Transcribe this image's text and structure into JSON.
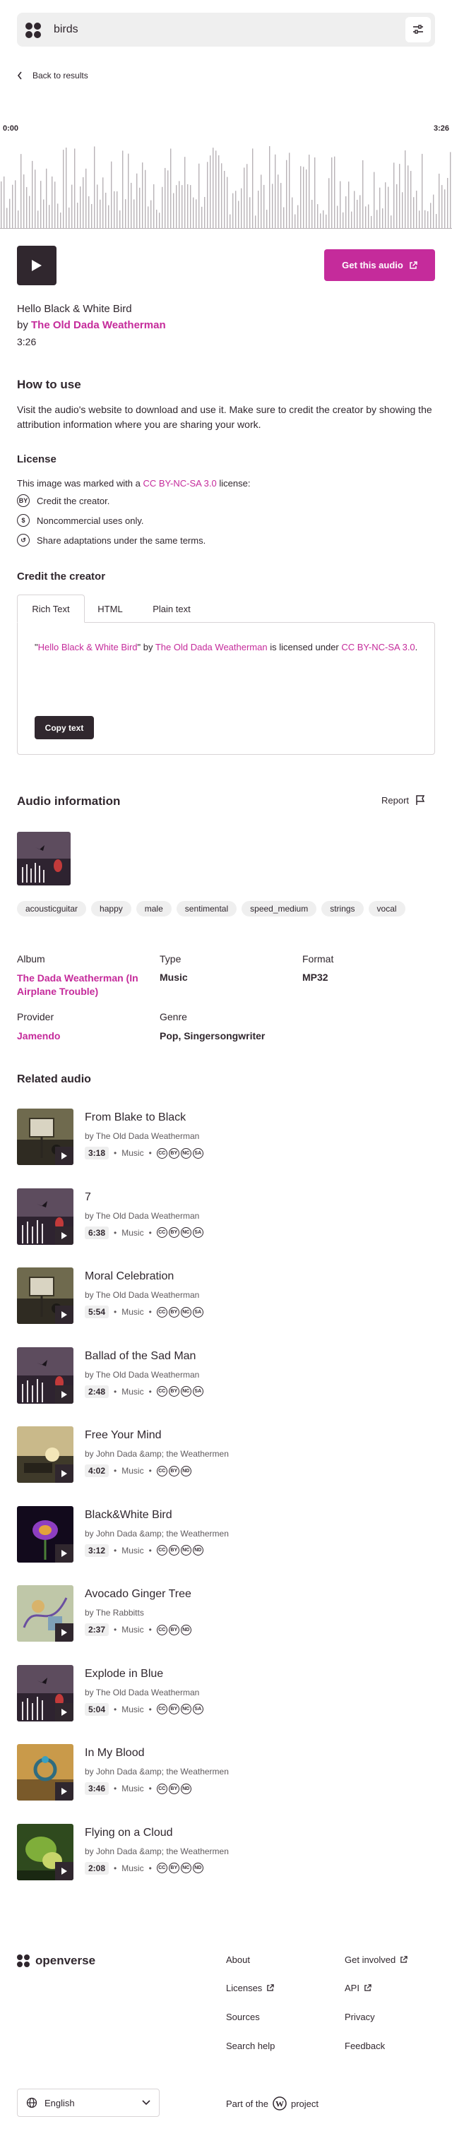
{
  "search": {
    "value": "birds"
  },
  "nav": {
    "back_label": "Back to results"
  },
  "player": {
    "current_time": "0:00",
    "total_time": "3:26",
    "get_label": "Get this audio"
  },
  "audio": {
    "title": "Hello Black & White Bird",
    "by_prefix": "by",
    "creator": "The Old Dada Weatherman",
    "duration": "3:26"
  },
  "how_to_use": {
    "heading": "How to use",
    "text": "Visit the audio's website to download and use it. Make sure to credit the creator by showing the attribution information where you are sharing your work."
  },
  "license": {
    "heading": "License",
    "intro_prefix": "This image was marked with a",
    "license_name": "CC BY-NC-SA 3.0",
    "intro_suffix": "license:",
    "items": [
      {
        "icon": "by-icon",
        "glyph": "BY",
        "text": "Credit the creator."
      },
      {
        "icon": "nc-icon",
        "glyph": "$",
        "text": "Noncommercial uses only."
      },
      {
        "icon": "sa-icon",
        "glyph": "↺",
        "text": "Share adaptations under the same terms."
      }
    ]
  },
  "credit": {
    "heading": "Credit the creator",
    "tabs": [
      "Rich Text",
      "HTML",
      "Plain text"
    ],
    "quote_open": "\"",
    "work": "Hello Black & White Bird",
    "quote_close": "\" by ",
    "creator": "The Old Dada Weatherman",
    "licensed_under": " is licensed under ",
    "license": "CC BY-NC-SA 3.0",
    "end": ".",
    "copy_label": "Copy text"
  },
  "info": {
    "heading": "Audio information",
    "report_label": "Report",
    "tags": [
      "acousticguitar",
      "happy",
      "male",
      "sentimental",
      "speed_medium",
      "strings",
      "vocal"
    ],
    "album_label": "Album",
    "album_value": "The Dada Weatherman (In Airplane Trouble)",
    "type_label": "Type",
    "type_value": "Music",
    "format_label": "Format",
    "format_value": "MP32",
    "provider_label": "Provider",
    "provider_value": "Jamendo",
    "genre_label": "Genre",
    "genre_value": "Pop, Singersongwriter"
  },
  "related": {
    "heading": "Related audio",
    "items": [
      {
        "title": "From Blake to Black",
        "by": "by The Old Dada Weatherman",
        "duration": "3:18",
        "category": "Music",
        "icons": [
          "CC",
          "BY",
          "NC",
          "SA"
        ],
        "art": "sign"
      },
      {
        "title": "7",
        "by": "by The Old Dada Weatherman",
        "duration": "6:38",
        "category": "Music",
        "icons": [
          "CC",
          "BY",
          "NC",
          "SA"
        ],
        "art": "dark"
      },
      {
        "title": "Moral Celebration",
        "by": "by The Old Dada Weatherman",
        "duration": "5:54",
        "category": "Music",
        "icons": [
          "CC",
          "BY",
          "NC",
          "SA"
        ],
        "art": "sign"
      },
      {
        "title": "Ballad of the Sad Man",
        "by": "by The Old Dada Weatherman",
        "duration": "2:48",
        "category": "Music",
        "icons": [
          "CC",
          "BY",
          "NC",
          "SA"
        ],
        "art": "dark"
      },
      {
        "title": "Free Your Mind",
        "by": "by John Dada &amp; the Weathermen",
        "duration": "4:02",
        "category": "Music",
        "icons": [
          "CC",
          "BY",
          "ND"
        ],
        "art": "sunset"
      },
      {
        "title": "Black&White Bird",
        "by": "by John Dada &amp; the Weathermen",
        "duration": "3:12",
        "category": "Music",
        "icons": [
          "CC",
          "BY",
          "NC",
          "ND"
        ],
        "art": "flower"
      },
      {
        "title": "Avocado Ginger Tree",
        "by": "by The Rabbitts",
        "duration": "2:37",
        "category": "Music",
        "icons": [
          "CC",
          "BY",
          "ND"
        ],
        "art": "sketch"
      },
      {
        "title": "Explode in Blue",
        "by": "by The Old Dada Weatherman",
        "duration": "5:04",
        "category": "Music",
        "icons": [
          "CC",
          "BY",
          "NC",
          "SA"
        ],
        "art": "dark"
      },
      {
        "title": "In My Blood",
        "by": "by John Dada &amp; the Weathermen",
        "duration": "3:46",
        "category": "Music",
        "icons": [
          "CC",
          "BY",
          "ND"
        ],
        "art": "ring"
      },
      {
        "title": "Flying on a Cloud",
        "by": "by John Dada &amp; the Weathermen",
        "duration": "2:08",
        "category": "Music",
        "icons": [
          "CC",
          "BY",
          "NC",
          "ND"
        ],
        "art": "green"
      }
    ]
  },
  "footer": {
    "brand": "openverse",
    "links": [
      "About",
      "Get involved",
      "Licenses",
      "API",
      "Sources",
      "Privacy",
      "Search help",
      "Feedback"
    ],
    "language": "English",
    "part_of_prefix": "Part of the",
    "part_of_suffix": "project"
  },
  "colors": {
    "accent": "#c52b9b",
    "dark": "#30272e",
    "chip": "#efefef"
  }
}
